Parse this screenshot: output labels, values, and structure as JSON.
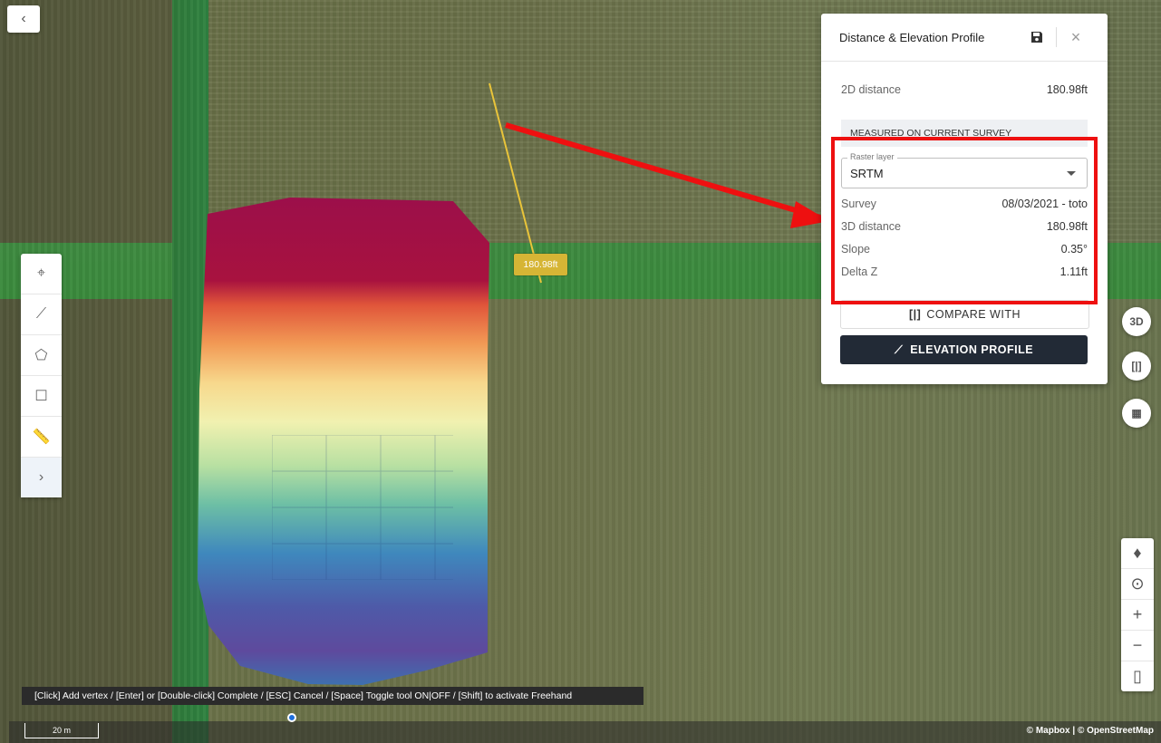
{
  "map": {
    "measurement_label": "180.98ft",
    "scale_label": "20 m",
    "attribution": "© Mapbox | © OpenStreetMap",
    "hint": "[Click] Add vertex / [Enter] or [Double-click] Complete / [ESC] Cancel / [Space] Toggle tool ON|OFF / [Shift] to activate Freehand"
  },
  "controls": {
    "back": "‹",
    "tools": [
      {
        "name": "point-tool",
        "icon": "crosshair-icon",
        "glyph": "⌖"
      },
      {
        "name": "line-tool",
        "icon": "polyline-icon",
        "glyph": "⟋"
      },
      {
        "name": "polygon-tool",
        "icon": "polygon-icon",
        "glyph": "⬠"
      },
      {
        "name": "rectangle-tool",
        "icon": "square-icon",
        "glyph": "☐"
      },
      {
        "name": "ruler-tool",
        "icon": "ruler-icon",
        "glyph": "📏"
      },
      {
        "name": "expand-toolbar",
        "icon": "chevron-right-icon",
        "glyph": "›"
      }
    ],
    "right_buttons": [
      {
        "name": "3d-toggle",
        "icon": "3d-icon",
        "glyph": "3D"
      },
      {
        "name": "compare-toggle",
        "icon": "compare-icon",
        "glyph": "[|]"
      },
      {
        "name": "layers-toggle",
        "icon": "layer-pin-icon",
        "glyph": "▦"
      }
    ],
    "zoom": [
      {
        "name": "compass",
        "icon": "compass-icon",
        "glyph": "♦"
      },
      {
        "name": "zoom-to-extent",
        "icon": "zoom-extent-icon",
        "glyph": "⊙"
      },
      {
        "name": "zoom-in",
        "icon": "plus-icon",
        "glyph": "+"
      },
      {
        "name": "zoom-out",
        "icon": "minus-icon",
        "glyph": "−"
      },
      {
        "name": "basemap",
        "icon": "map-icon",
        "glyph": "▯"
      }
    ]
  },
  "panel": {
    "title": "Distance & Elevation Profile",
    "distance_2d_label": "2D distance",
    "distance_2d_value": "180.98ft",
    "measured_header": "MEASURED ON CURRENT SURVEY",
    "raster_label": "Raster layer",
    "raster_value": "SRTM",
    "rows": [
      {
        "label": "Survey",
        "value": "08/03/2021 - toto"
      },
      {
        "label": "3D distance",
        "value": "180.98ft"
      },
      {
        "label": "Slope",
        "value": "0.35°"
      },
      {
        "label": "Delta Z",
        "value": "1.11ft"
      }
    ],
    "compare_button": "COMPARE WITH",
    "elevation_button": "ELEVATION PROFILE"
  },
  "colors": {
    "highlight": "#ee1010",
    "measure_line": "#e9c43a",
    "primary_button": "#222a36"
  }
}
